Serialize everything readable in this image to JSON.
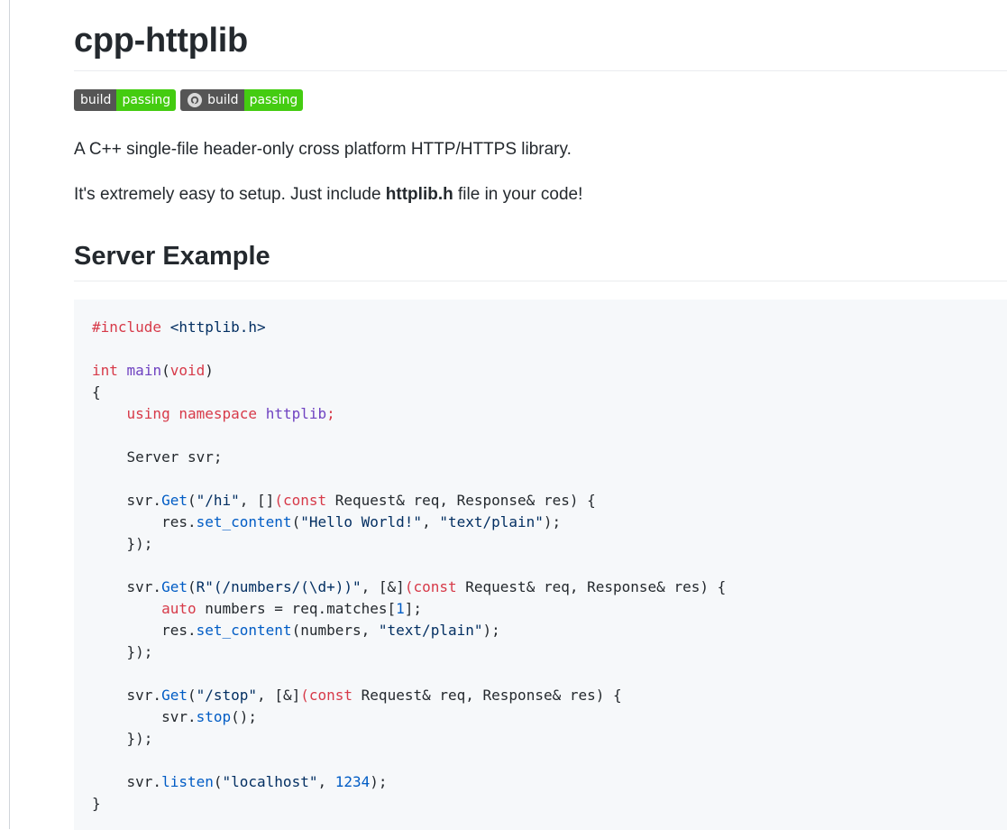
{
  "title": "cpp-httplib",
  "badges": [
    {
      "label": "build",
      "status": "passing",
      "icon": "none"
    },
    {
      "label": "build",
      "status": "passing",
      "icon": "appveyor-icon"
    }
  ],
  "intro": {
    "line1": "A C++ single-file header-only cross platform HTTP/HTTPS library.",
    "line2_before": "It's extremely easy to setup. Just include ",
    "line2_bold": "httplib.h",
    "line2_after": " file in your code!"
  },
  "section_title": "Server Example",
  "code": {
    "l1a": "#include",
    "l1b": " <httplib.h>",
    "l3a": "int",
    "l3b": " ",
    "l3c": "main",
    "l3d": "(",
    "l3e": "void",
    "l3f": ")",
    "l4": "{",
    "l5a": "    ",
    "l5b": "using",
    "l5c": " ",
    "l5d": "namespace",
    "l5e": " ",
    "l5f": "httplib",
    "l5g": ";",
    "l7": "    Server svr;",
    "l9a": "    svr.",
    "l9b": "Get",
    "l9c": "(",
    "l9d": "\"/hi\"",
    "l9e": ", []",
    "l9f": "(",
    "l9g": "const",
    "l9h": " Request& req, Response& res) {",
    "l10a": "        res.",
    "l10b": "set_content",
    "l10c": "(",
    "l10d": "\"Hello World!\"",
    "l10e": ", ",
    "l10f": "\"text/plain\"",
    "l10g": ");",
    "l11": "    });",
    "l13a": "    svr.",
    "l13b": "Get",
    "l13c": "(",
    "l13d": "R\"(/numbers/(\\d+))\"",
    "l13e": ", [&]",
    "l13f": "(",
    "l13g": "const",
    "l13h": " Request& req, Response& res) {",
    "l14a": "        ",
    "l14b": "auto",
    "l14c": " numbers = req.matches[",
    "l14d": "1",
    "l14e": "];",
    "l15a": "        res.",
    "l15b": "set_content",
    "l15c": "(numbers, ",
    "l15d": "\"text/plain\"",
    "l15e": ");",
    "l16": "    });",
    "l18a": "    svr.",
    "l18b": "Get",
    "l18c": "(",
    "l18d": "\"/stop\"",
    "l18e": ", [&]",
    "l18f": "(",
    "l18g": "const",
    "l18h": " Request& req, Response& res) {",
    "l19a": "        svr.",
    "l19b": "stop",
    "l19c": "();",
    "l20": "    });",
    "l22a": "    svr.",
    "l22b": "listen",
    "l22c": "(",
    "l22d": "\"localhost\"",
    "l22e": ", ",
    "l22f": "1234",
    "l22g": ");",
    "l23": "}"
  }
}
